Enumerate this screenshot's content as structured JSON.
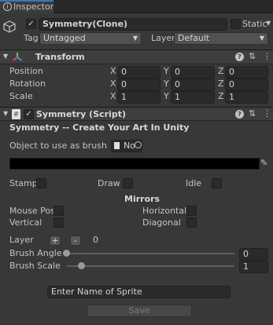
{
  "tab": {
    "title": "Inspector"
  },
  "object": {
    "name": "Symmetry(Clone)",
    "static_label": "Static"
  },
  "tag": {
    "label": "Tag",
    "value": "Untagged"
  },
  "layer": {
    "label": "Layer",
    "value": "Default"
  },
  "transform": {
    "title": "Transform",
    "rows": [
      {
        "label": "Position",
        "x": "0",
        "y": "0",
        "z": "0"
      },
      {
        "label": "Rotation",
        "x": "0",
        "y": "0",
        "z": "0"
      },
      {
        "label": "Scale",
        "x": "1",
        "y": "1",
        "z": "1"
      }
    ],
    "axes": {
      "x": "X",
      "y": "Y",
      "z": "Z"
    }
  },
  "script": {
    "title": "Symmetry (Script)",
    "subtitle": "Symmetry -- Create Your Art In Unity",
    "brush_label": "Object to use as brush",
    "brush_value": "No",
    "modes": {
      "stamp": "Stamp",
      "draw": "Draw",
      "idle": "Idle"
    },
    "mirrors_title": "Mirrors",
    "mirrors": {
      "mouse_pos": "Mouse Pos",
      "horizontal": "Horizontal",
      "vertical": "Vertical",
      "diagonal": "Diagonal"
    },
    "layer_label": "Layer",
    "layer_plus": "+",
    "layer_minus": "-",
    "layer_value": "0",
    "brush_angle_label": "Brush Angle",
    "brush_angle_value": "0",
    "brush_scale_label": "Brush Scale",
    "brush_scale_value": "1",
    "sprite_name": "Enter Name of Sprite",
    "save_label": "Save"
  },
  "colors": {
    "background": "#383838",
    "header": "#3e3e3e",
    "field": "#2a2a2a",
    "color_field": "#000000"
  }
}
